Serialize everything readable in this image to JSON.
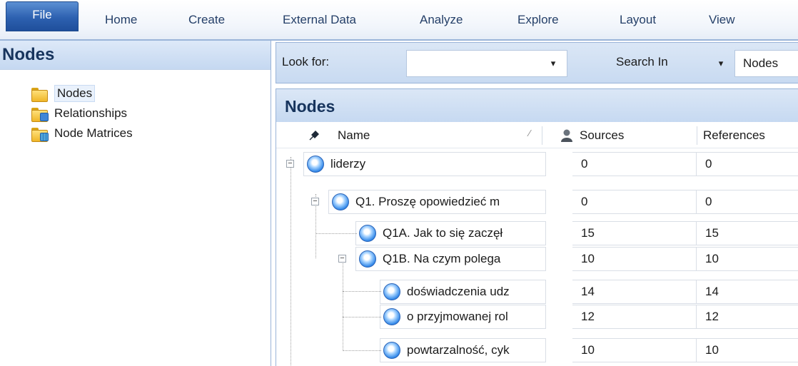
{
  "menu": {
    "tabs": [
      "File",
      "Home",
      "Create",
      "External Data",
      "Analyze",
      "Explore",
      "Layout",
      "View"
    ]
  },
  "nav": {
    "title": "Nodes",
    "items": [
      {
        "label": "Nodes",
        "icon": "folder-open-icon"
      },
      {
        "label": "Relationships",
        "icon": "relationships-folder-icon"
      },
      {
        "label": "Node Matrices",
        "icon": "node-matrices-folder-icon"
      }
    ]
  },
  "find": {
    "look_for_label": "Look for:",
    "look_for_value": "",
    "search_in_label": "Search In",
    "search_in_value": "Nodes",
    "dropdown_glyph": "▾"
  },
  "list": {
    "title": "Nodes",
    "columns": {
      "name": "Name",
      "sources": "Sources",
      "references": "References"
    },
    "rows": [
      {
        "name": "liderzy",
        "sources": "0",
        "references": "0"
      },
      {
        "name": "Q1. Proszę opowiedzieć m",
        "sources": "0",
        "references": "0"
      },
      {
        "name": "Q1A. Jak to się zaczęł",
        "sources": "15",
        "references": "15"
      },
      {
        "name": "Q1B. Na czym polega",
        "sources": "10",
        "references": "10"
      },
      {
        "name": "doświadczenia udz",
        "sources": "14",
        "references": "14"
      },
      {
        "name": "o przyjmowanej rol",
        "sources": "12",
        "references": "12"
      },
      {
        "name": "powtarzalność, cyk",
        "sources": "10",
        "references": "10"
      }
    ]
  },
  "colors": {
    "accent": "#2d61b0",
    "header_bg": "#c8daf1",
    "title_text": "#17345d"
  }
}
